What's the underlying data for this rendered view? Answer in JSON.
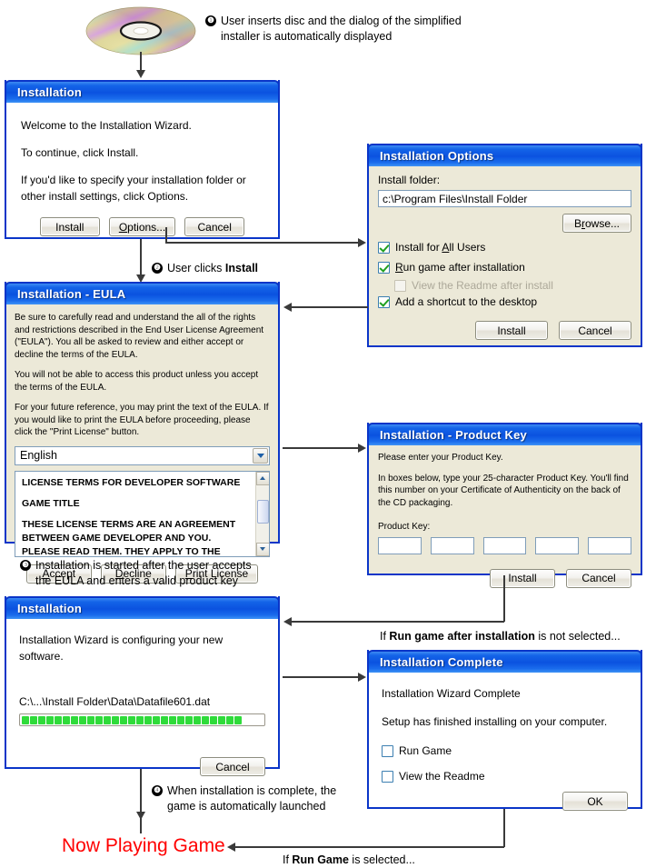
{
  "flow": {
    "annotations": [
      {
        "num": "❶",
        "line1": "User inserts disc and the dialog of the simplified",
        "line2": "installer is automatically displayed"
      },
      {
        "num": "❷",
        "pre": "User clicks ",
        "bold": "Install"
      },
      {
        "num": "❸",
        "line1": "Installation is started after the user accepts",
        "line2": "the EULA and enters a valid product key"
      },
      {
        "num": "❹",
        "line1": "When installation is complete, the",
        "line2": "game is automatically launched"
      }
    ],
    "branch_not_selected": {
      "pre": "If ",
      "bold": "Run game after installation",
      "post": " is not selected..."
    },
    "branch_run_game": {
      "pre": "If ",
      "bold": "Run Game",
      "post": " is selected..."
    },
    "final_state": "Now Playing Game",
    "final_state_color": "#ff0000"
  },
  "media": {
    "disc_label": "installation-disc"
  },
  "install_dialog": {
    "title": "Installation",
    "lines": [
      "Welcome to the Installation Wizard.",
      "To continue, click Install.",
      "If you'd like to specify your installation folder or other install settings, click Options."
    ],
    "buttons": [
      {
        "label": "Install",
        "name": "install-button"
      },
      {
        "label": "Options...",
        "name": "options-button",
        "accel": "O"
      },
      {
        "label": "Cancel",
        "name": "cancel-button"
      }
    ]
  },
  "options_dialog": {
    "title": "Installation Options",
    "folder_label": "Install folder:",
    "folder_value": "c:\\Program Files\\Install Folder",
    "browse_label": "Browse...",
    "browse_accel": "r",
    "checkboxes": [
      {
        "label": "Install for All Users",
        "checked": true,
        "disabled": false,
        "accel": "A",
        "name": "checkbox-install-all-users"
      },
      {
        "label": "Run game after installation",
        "checked": true,
        "disabled": false,
        "accel": "R",
        "name": "checkbox-run-game-after-install"
      },
      {
        "label": "View the Readme after install",
        "checked": false,
        "disabled": true,
        "name": "checkbox-view-readme-after-install"
      },
      {
        "label": "Add a shortcut to the desktop",
        "checked": true,
        "disabled": false,
        "name": "checkbox-add-desktop-shortcut"
      }
    ],
    "buttons": [
      {
        "label": "Install",
        "name": "install-button"
      },
      {
        "label": "Cancel",
        "name": "cancel-button"
      }
    ]
  },
  "eula_dialog": {
    "title": "Installation - EULA",
    "paragraphs": [
      "Be sure to carefully read and understand the all of the rights and restrictions described in the End User License Agreement (\"EULA\"). You all be asked to review and either accept or decline the terms of the EULA.",
      "You will not be able to access this product unless you accept the terms of the EULA.",
      "For your future reference, you may print the text of the EULA.  If you would like to print the EULA before proceeding, please click the \"Print License\" button."
    ],
    "language_selected": "English",
    "license_text": [
      "LICENSE TERMS FOR DEVELOPER SOFTWARE",
      "GAME TITLE",
      "THESE LICENSE TERMS ARE AN AGREEMENT BETWEEN GAME DEVELOPER AND YOU.  PLEASE READ THEM.  THEY APPLY TO THE SOFTWARE..."
    ],
    "buttons": [
      {
        "label": "Accept",
        "name": "accept-button",
        "accel": "A"
      },
      {
        "label": "Decline",
        "name": "decline-button",
        "accel": "D"
      },
      {
        "label": "Print License",
        "name": "print-license-button",
        "accel": "P"
      }
    ]
  },
  "product_key_dialog": {
    "title": "Installation - Product Key",
    "paragraphs": [
      "Please enter your Product Key.",
      "In boxes below, type your 25-character Product Key.  You'll find this number on your Certificate of Authenticity on the back of the CD packaging."
    ],
    "field_label": "Product Key:",
    "key_fields": [
      "",
      "",
      "",
      "",
      ""
    ],
    "buttons": [
      {
        "label": "Install",
        "name": "install-button"
      },
      {
        "label": "Cancel",
        "name": "cancel-button"
      }
    ]
  },
  "progress_dialog": {
    "title": "Installation",
    "status": "Installation Wizard is configuring your new software.",
    "current_file": "C:\\...\\Install Folder\\Data\\Datafile601.dat",
    "progress_segments_filled": 27,
    "progress_segments_total": 40,
    "progress_color": "#2fdb3a",
    "buttons": [
      {
        "label": "Cancel",
        "name": "cancel-button"
      }
    ]
  },
  "complete_dialog": {
    "title": "Installation Complete",
    "heading": "Installation Wizard Complete",
    "subtext": "Setup has finished installing on your computer.",
    "checkboxes": [
      {
        "label": "Run Game",
        "checked": false,
        "name": "checkbox-run-game"
      },
      {
        "label": "View the Readme",
        "checked": false,
        "name": "checkbox-view-readme"
      }
    ],
    "buttons": [
      {
        "label": "OK",
        "name": "ok-button"
      }
    ]
  },
  "theme": {
    "title_blue": "#0b52e0",
    "dialog_border": "#0a35c8",
    "dialog_face": "#ece9d8"
  }
}
